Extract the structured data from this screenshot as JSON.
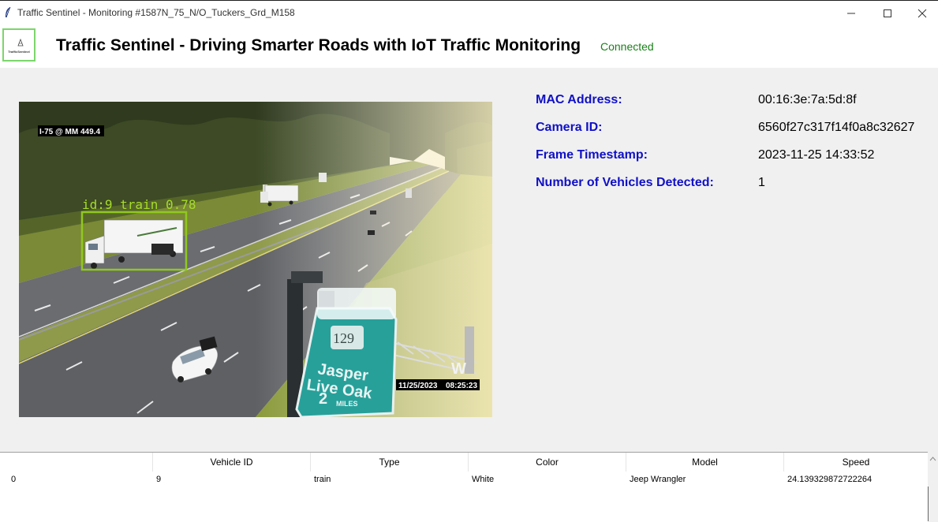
{
  "window": {
    "title": "Traffic Sentinel - Monitoring #1587N_75_N/O_Tuckers_Grd_M158"
  },
  "header": {
    "logo_text": "TrafficSentinel",
    "heading": "Traffic Sentinel - Driving Smarter Roads with IoT Traffic Monitoring",
    "status": "Connected",
    "status_color": "#1a7f1a"
  },
  "camera": {
    "location_label": "I-75 @ MM 449.4",
    "detection_label": "id:9  train  0.78",
    "overlay_date": "11/25/2023",
    "overlay_time": "08:25:23",
    "sign_number": "129",
    "sign_line1": "Jasper",
    "sign_line2": "Live Oak",
    "sign_line3": "2",
    "sign_line3_unit": "MILES"
  },
  "info": {
    "mac_label": "MAC Address:",
    "mac_value": "00:16:3e:7a:5d:8f",
    "camera_id_label": "Camera ID:",
    "camera_id_value": "6560f27c317f14f0a8c32627",
    "timestamp_label": "Frame Timestamp:",
    "timestamp_value": "2023-11-25 14:33:52",
    "vehicles_label": "Number of Vehicles Detected:",
    "vehicles_value": "1",
    "label_color": "#1010c8"
  },
  "table": {
    "columns": [
      "",
      "Vehicle ID",
      "Type",
      "Color",
      "Model",
      "Speed"
    ],
    "rows": [
      [
        "0",
        "9",
        "train",
        "White",
        "Jeep Wrangler",
        "24.139329872722264"
      ]
    ]
  }
}
